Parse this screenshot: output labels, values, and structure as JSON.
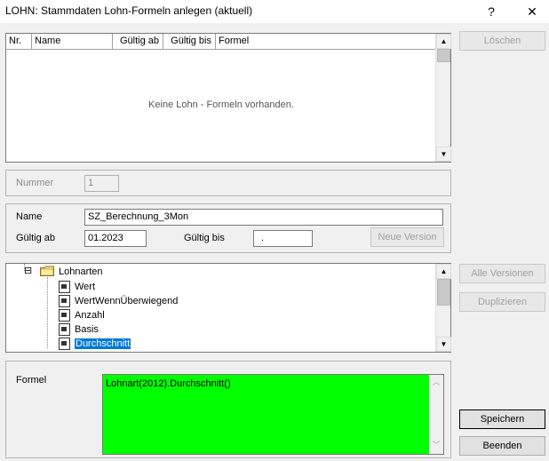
{
  "window": {
    "title": "LOHN: Stammdaten Lohn-Formeln anlegen (aktuell)",
    "help": "?",
    "close": "✕"
  },
  "table": {
    "columns": [
      "Nr.",
      "Name",
      "Gültig ab",
      "Gültig bis",
      "Formel"
    ],
    "empty_message": "Keine Lohn - Formeln vorhanden."
  },
  "buttons": {
    "loeschen": "Löschen",
    "neue_version": "Neue Version",
    "alle_versionen": "Alle Versionen",
    "duplizieren": "Duplizieren",
    "speichern": "Speichern",
    "beenden": "Beenden"
  },
  "nummer": {
    "label": "Nummer",
    "value": "1"
  },
  "details": {
    "name_label": "Name",
    "name_value": "SZ_Berechnung_3Mon",
    "gueltig_ab_label": "Gültig ab",
    "gueltig_ab_value": "01.2023",
    "gueltig_bis_label": "Gültig bis",
    "gueltig_bis_value": "."
  },
  "tree": {
    "expander": "⊟",
    "root": "Lohnarten",
    "items": [
      "Wert",
      "WertWennÜberwiegend",
      "Anzahl",
      "Basis",
      "Durchschnitt"
    ],
    "selected_index": 4
  },
  "formel": {
    "label": "Formel",
    "value": "Lohnart(2012).Durchschnitt()",
    "editor_bg": "#00ff00"
  }
}
